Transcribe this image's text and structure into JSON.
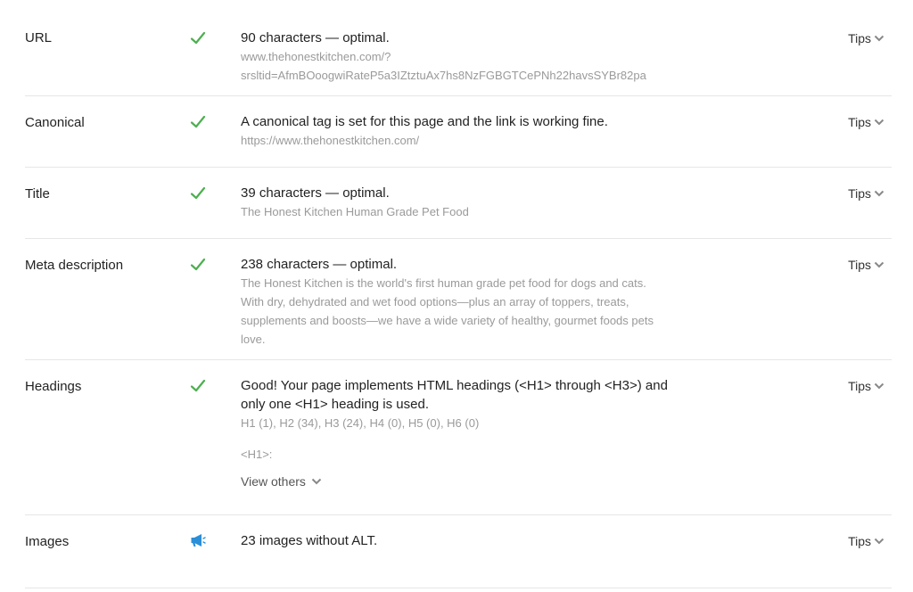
{
  "colors": {
    "check": "#4caf50",
    "info": "#2b8fd8",
    "muted": "#9a9a9a",
    "divider": "#e6e6e6"
  },
  "rows": [
    {
      "label": "URL",
      "status_icon": "check-icon",
      "main": "90 characters — optimal.",
      "sub_lines": [
        "www.thehonestkitchen.com/?",
        "srsltid=AfmBOoogwiRateP5a3IZtztuAx7hs8NzFGBGTCePNh22havsSYBr82pa"
      ],
      "tips": "Tips"
    },
    {
      "label": "Canonical",
      "status_icon": "check-icon",
      "main": "A canonical tag is set for this page and the link is working fine.",
      "sub_lines": [
        "https://www.thehonestkitchen.com/"
      ],
      "tips": "Tips"
    },
    {
      "label": "Title",
      "status_icon": "check-icon",
      "main": "39 characters — optimal.",
      "sub_lines": [
        "The Honest Kitchen Human Grade Pet Food"
      ],
      "tips": "Tips"
    },
    {
      "label": "Meta description",
      "status_icon": "check-icon",
      "main": "238 characters — optimal.",
      "sub_lines": [
        "The Honest Kitchen is the world's first human grade pet food for dogs and cats.",
        "With dry, dehydrated and wet food options—plus an array of toppers, treats,",
        "supplements and boosts—we have a wide variety of healthy, gourmet foods pets",
        "love."
      ],
      "tips": "Tips"
    },
    {
      "label": "Headings",
      "status_icon": "check-icon",
      "main_lines": [
        "Good! Your page implements HTML headings (<H1> through <H3>) and",
        "only one <H1> heading is used."
      ],
      "sub_lines": [
        "H1 (1), H2 (34), H3 (24), H4 (0), H5 (0), H6 (0)"
      ],
      "h1_label": "<H1>:",
      "view_others": "View others",
      "tips": "Tips"
    },
    {
      "label": "Images",
      "status_icon": "megaphone-icon",
      "main": "23 images without ALT.",
      "tips": "Tips"
    }
  ]
}
